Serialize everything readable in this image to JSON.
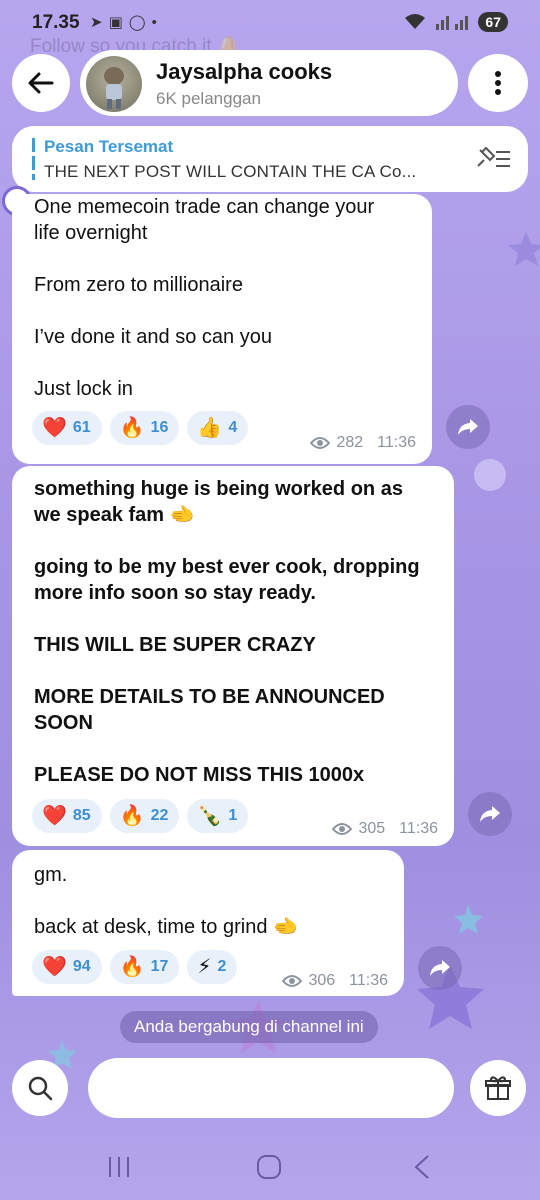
{
  "status": {
    "time": "17.35",
    "battery": "67"
  },
  "background_hint": "Follow so you catch it 🔔",
  "header": {
    "channel_name": "Jaysalpha cooks",
    "subscribers": "6K pelanggan"
  },
  "pinned": {
    "label": "Pesan Tersemat",
    "text": "THE NEXT POST WILL CONTAIN THE CA  Co..."
  },
  "messages": [
    {
      "text": "One memecoin trade can change your\nlife overnight\n\nFrom zero to millionaire\n\nI’ve done it and so can you\n\nJust lock in",
      "reactions": [
        {
          "emoji": "❤️",
          "count": "61"
        },
        {
          "emoji": "🔥",
          "count": "16"
        },
        {
          "emoji": "👍",
          "count": "4"
        }
      ],
      "views": "282",
      "time": "11:36"
    },
    {
      "text": "something huge is being worked on as\nwe speak fam 🫲\n\ngoing to be my best ever cook, dropping\nmore info soon so stay ready.\n\nTHIS WILL BE SUPER CRAZY\n\nMORE DETAILS TO BE ANNOUNCED\nSOON\n\nPLEASE DO NOT MISS THIS 1000x",
      "reactions": [
        {
          "emoji": "❤️",
          "count": "85"
        },
        {
          "emoji": "🔥",
          "count": "22"
        },
        {
          "emoji": "🍾",
          "count": "1"
        }
      ],
      "views": "305",
      "time": "11:36"
    },
    {
      "text": "gm.\n\nback at desk, time to grind 🫲",
      "reactions": [
        {
          "emoji": "❤️",
          "count": "94"
        },
        {
          "emoji": "🔥",
          "count": "17"
        },
        {
          "emoji": "⚡",
          "count": "2"
        }
      ],
      "views": "306",
      "time": "11:36"
    }
  ],
  "system_message": "Anda bergabung di channel ini",
  "icons": {
    "back": "arrow-left-icon",
    "menu": "vertical-dots-icon",
    "pin_list": "pin-list-icon",
    "share": "share-arrow-icon",
    "search": "search-icon",
    "gift": "gift-icon",
    "views": "eye-icon"
  }
}
